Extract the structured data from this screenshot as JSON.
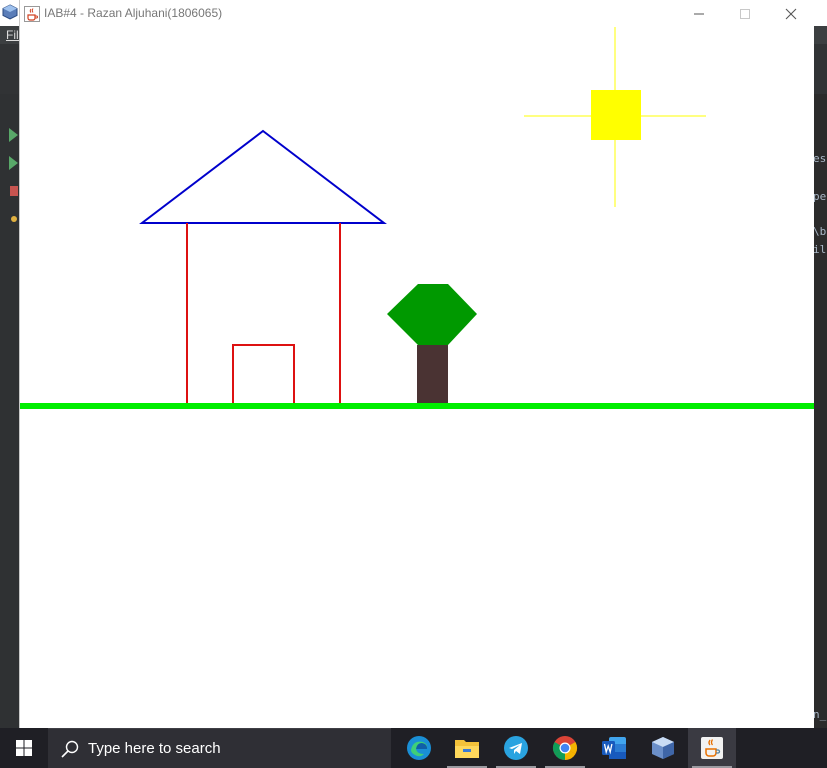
{
  "ide": {
    "menu_file": "File",
    "right_code_lines": [
      "es",
      "pe",
      "\\b",
      "il",
      "n_"
    ]
  },
  "window": {
    "title": "IAB#4 - Razan Aljuhani(1806065)",
    "controls": [
      "minimize-icon",
      "maximize-icon",
      "close-icon"
    ]
  },
  "drawing": {
    "colors": {
      "ground": "#00ee00",
      "house": "#dd1111",
      "roof": "#0000cc",
      "tree_leaves": "#009900",
      "tree_trunk": "#4a3333",
      "sun": "#ffff00"
    }
  },
  "taskbar": {
    "search_placeholder": "Type here to search",
    "apps": [
      "edge-icon",
      "file-explorer-icon",
      "telegram-icon",
      "chrome-icon",
      "word-icon",
      "virtualbox-icon",
      "java-icon"
    ]
  }
}
